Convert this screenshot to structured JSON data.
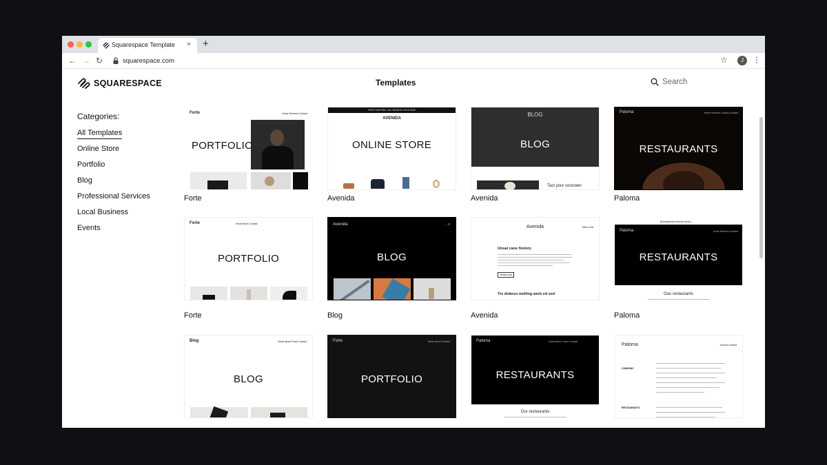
{
  "browser": {
    "tab_title": "Squarespace Template",
    "tab_close": "×",
    "new_tab": "+",
    "back": "←",
    "forward": "→",
    "reload": "↻",
    "url": "squarespace.com",
    "star": "☆",
    "profile_initial": "J",
    "menu": "⋮",
    "traffic_lights": [
      "#ff5f57",
      "#febc2e",
      "#28c840"
    ]
  },
  "header": {
    "logo_text": "SQUARESPACE",
    "title": "Templates",
    "search_label": "Search"
  },
  "sidebar": {
    "heading": "Categories:",
    "items": [
      {
        "label": "All Templates",
        "active": true
      },
      {
        "label": "Online Store",
        "active": false
      },
      {
        "label": "Portfolio",
        "active": false
      },
      {
        "label": "Blog",
        "active": false
      },
      {
        "label": "Professional Services",
        "active": false
      },
      {
        "label": "Local Business",
        "active": false
      },
      {
        "label": "Events",
        "active": false
      }
    ]
  },
  "templates": [
    {
      "name": "Forte",
      "headline": "PORTFOLIO",
      "site": "Forte",
      "nav": "Home  Services  Contact"
    },
    {
      "name": "Avenida",
      "headline": "ONLINE STORE",
      "site": "AVENIDA",
      "nav": "FREE SHIPPING ON ORDERS OVER $150"
    },
    {
      "name": "Avenida",
      "headline": "BLOG",
      "site": "BLOG",
      "nav": "",
      "caption_line": "Tact your concown"
    },
    {
      "name": "Paloma",
      "headline": "RESTAURANTS",
      "site": "Paloma",
      "nav": "Home  Reserve  Contact  Contact"
    },
    {
      "name": "Forte",
      "headline": "PORTFOLIO",
      "site": "Forte",
      "nav": "Home  Work  Contact"
    },
    {
      "name": "Blog",
      "headline": "BLOG",
      "site": "Avenida",
      "nav": ""
    },
    {
      "name": "Avenida",
      "headline": "",
      "site": "Avenida",
      "nav": "Menu  Cart",
      "post1": "Unsal cane history",
      "post2": "Tre dobeso melling werk ed sed",
      "button": "Read more"
    },
    {
      "name": "Paloma",
      "headline": "RESTAURANTS",
      "site": "Paloma",
      "nav": "Home  Reserve  Contact",
      "section": "Ouu restaurants",
      "banner": "Brawidant the bereset at-hon"
    },
    {
      "name": "",
      "headline": "BLOG",
      "site": "Blog",
      "nav": "Home  About  Posts  Contact"
    },
    {
      "name": "",
      "headline": "PORTFOLIO",
      "site": "Forte",
      "nav": "Home  About  Contact"
    },
    {
      "name": "",
      "headline": "RESTAURANTS",
      "site": "Paloma",
      "nav": "Home  Menu  Hours  Contact",
      "section": "Our restaurants"
    },
    {
      "name": "",
      "headline": "",
      "site": "Paloma",
      "nav": "Journal  Contact",
      "labels": [
        "COMPANY",
        "RESTAURANTS"
      ]
    }
  ]
}
